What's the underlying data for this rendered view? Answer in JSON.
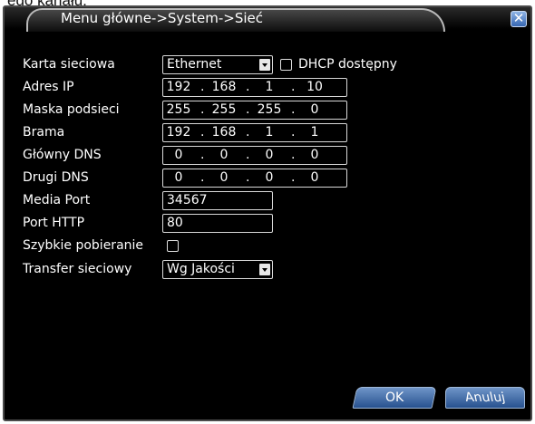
{
  "page_snippet": "ego kanału,",
  "window": {
    "title": "Menu główne->System->Sieć",
    "close_glyph": "✕"
  },
  "form": {
    "network_card": {
      "label": "Karta sieciowa",
      "value": "Ethernet"
    },
    "dhcp": {
      "label": "DHCP dostępny",
      "checked": false
    },
    "ip_address": {
      "label": "Adres IP",
      "octets": [
        "192",
        "168",
        "1",
        "10"
      ]
    },
    "subnet_mask": {
      "label": "Maska podsieci",
      "octets": [
        "255",
        "255",
        "255",
        "0"
      ]
    },
    "gateway": {
      "label": "Brama",
      "octets": [
        "192",
        "168",
        "1",
        "1"
      ]
    },
    "primary_dns": {
      "label": "Główny DNS",
      "octets": [
        "0",
        "0",
        "0",
        "0"
      ]
    },
    "secondary_dns": {
      "label": "Drugi DNS",
      "octets": [
        "0",
        "0",
        "0",
        "0"
      ]
    },
    "media_port": {
      "label": "Media Port",
      "value": "34567"
    },
    "http_port": {
      "label": "Port HTTP",
      "value": "80"
    },
    "fast_download": {
      "label": "Szybkie pobieranie",
      "checked": false
    },
    "network_transfer": {
      "label": "Transfer sieciowy",
      "value": "Wg Jakości"
    }
  },
  "buttons": {
    "ok": "OK",
    "cancel": "Anuluj"
  },
  "colors": {
    "background": "#000000",
    "button_blue": "#3a66a8",
    "field_border": "#d9d9d9"
  }
}
